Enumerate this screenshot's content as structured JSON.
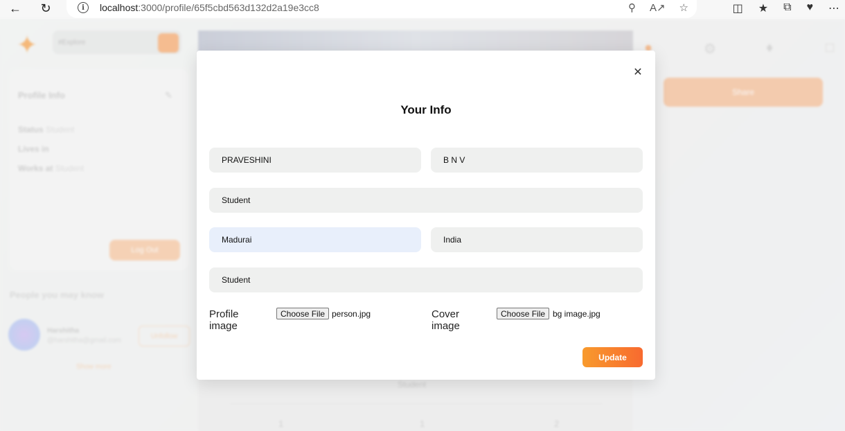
{
  "browser": {
    "url_host": "localhost",
    "url_rest": ":3000/profile/65f5cbd563d132d2a19e3cc8"
  },
  "background": {
    "search_placeholder": "#Explore",
    "profile_info_heading": "Profile Info",
    "status_label": "Status",
    "status_value": "Student",
    "lives_label": "Lives in",
    "works_label": "Works at",
    "works_value": "Student",
    "logout_label": "Log Out",
    "people_heading": "People you may know",
    "person_name": "Harshitha",
    "person_email": "@harshitha@gmail.com",
    "follow_label": "Unfollow",
    "show_more": "Show more",
    "share_label": "Share",
    "profile_status": "Student",
    "stats": [
      "1",
      "1",
      "2"
    ]
  },
  "modal": {
    "title": "Your Info",
    "first_name": "PRAVESHINI",
    "last_name": "B N V",
    "works_at": "Student",
    "lives_in": "Madurai",
    "country": "India",
    "relationship": "Student",
    "profile_image_label": "Profile image",
    "profile_choose": "Choose File",
    "profile_file": "person.jpg",
    "cover_image_label": "Cover image",
    "cover_choose": "Choose File",
    "cover_file": "bg image.jpg",
    "update_label": "Update"
  },
  "colors": {
    "accent": "#f89a2d",
    "accent_end": "#f86a2f",
    "field_bg": "#eff0ef",
    "field_focused_bg": "#e8effb"
  }
}
